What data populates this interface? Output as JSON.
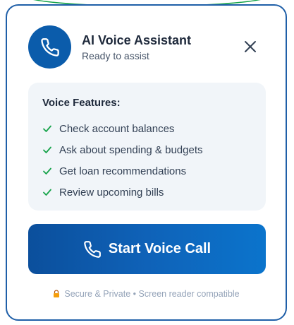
{
  "header": {
    "title": "AI Voice Assistant",
    "subtitle": "Ready to assist",
    "avatar_icon": "phone-icon",
    "close_icon": "close-icon"
  },
  "features": {
    "title": "Voice Features:",
    "items": [
      {
        "label": "Check account balances",
        "icon": "check-icon"
      },
      {
        "label": "Ask about spending & budgets",
        "icon": "check-icon"
      },
      {
        "label": "Get loan recommendations",
        "icon": "check-icon"
      },
      {
        "label": "Review upcoming bills",
        "icon": "check-icon"
      }
    ]
  },
  "call_button": {
    "label": "Start Voice Call",
    "icon": "phone-icon"
  },
  "footer": {
    "icon": "lock-icon",
    "text": "Secure & Private • Screen reader compatible"
  },
  "colors": {
    "brand": "#0b5cab",
    "check": "#16a34a",
    "border": "#1f5fa8"
  }
}
